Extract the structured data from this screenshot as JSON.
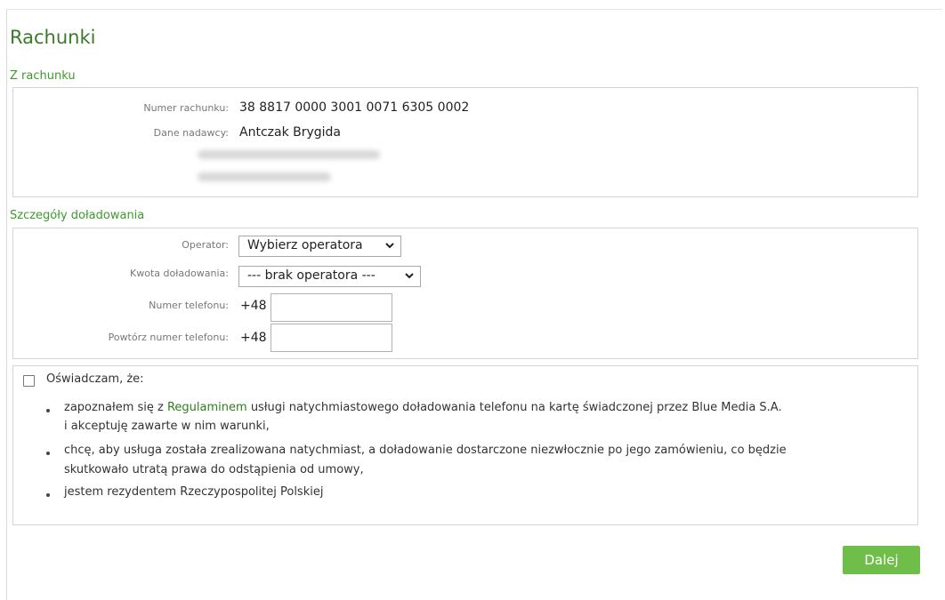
{
  "page": {
    "title": "Rachunki"
  },
  "from_account": {
    "section_title": "Z rachunku",
    "account_number_label": "Numer rachunku:",
    "account_number": "38 8817 0000 3001 0071 6305 0002",
    "sender_label": "Dane nadawcy:",
    "sender_name": "Antczak Brygida"
  },
  "topup": {
    "section_title": "Szczegóły doładowania",
    "operator_label": "Operator:",
    "operator_value": "Wybierz operatora",
    "amount_label": "Kwota doładowania:",
    "amount_value": "--- brak operatora ---",
    "phone_label": "Numer telefonu:",
    "phone_prefix": "+48",
    "phone_value": "",
    "phone_repeat_label": "Powtórz numer telefonu:",
    "phone_repeat_prefix": "+48",
    "phone_repeat_value": ""
  },
  "consent": {
    "checked": false,
    "label": "Oświadczam, że:",
    "item1_before": "zapoznałem się z ",
    "item1_link": "Regulaminem",
    "item1_after": " usługi natychmiastowego doładowania telefonu na kartę świadczonej przez Blue Media S.A.",
    "item1_line2": "i akceptuję zawarte w nim warunki,",
    "item2_line1": "chcę, aby usługa została zrealizowana natychmiast, a doładowanie dostarczone niezwłocznie po jego zamówieniu, co będzie",
    "item2_line2": "skutkowało utratą prawa do odstąpienia od umowy,",
    "item3": "jestem rezydentem Rzeczypospolitej Polskiej"
  },
  "actions": {
    "next_label": "Dalej"
  },
  "colors": {
    "accent": "#3c9a2a",
    "button": "#6fbe4a"
  },
  "icons": {
    "select_arrow": "chevron-down-icon"
  }
}
